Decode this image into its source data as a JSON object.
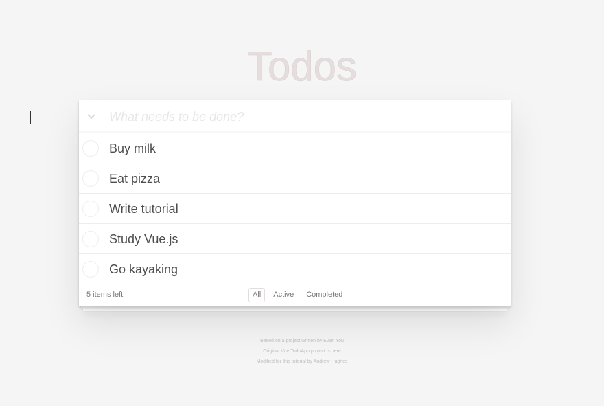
{
  "header": {
    "title": "Todos"
  },
  "new_todo": {
    "placeholder": "What needs to be done?",
    "value": ""
  },
  "todos": [
    {
      "label": "Buy milk",
      "completed": false
    },
    {
      "label": "Eat pizza",
      "completed": false
    },
    {
      "label": "Write tutorial",
      "completed": false
    },
    {
      "label": "Study Vue.js",
      "completed": false
    },
    {
      "label": "Go kayaking",
      "completed": false
    }
  ],
  "footer": {
    "count": "5 items left",
    "filters": [
      "All",
      "Active",
      "Completed"
    ],
    "selected_filter": "All"
  },
  "info": {
    "line1": "Based on a project written by Evan You",
    "line2": "Original Vue TodoApp project is here",
    "line3": "Modified for this tutorial by Andrew Hughes"
  },
  "icons": {
    "toggle_all": "chevron-down-icon"
  },
  "colors": {
    "title": "#e6dede",
    "background": "#f5f5f5",
    "text": "#4d4d4d",
    "placeholder": "#e6e6e6"
  }
}
